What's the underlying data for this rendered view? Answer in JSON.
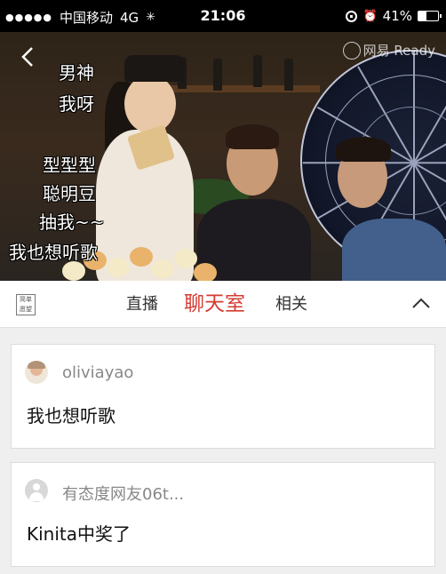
{
  "status_bar": {
    "carrier": "中国移动",
    "network": "4G",
    "time": "21:06",
    "battery": "41%",
    "battery_level": 0.41
  },
  "video": {
    "watermark": "网易 Ready",
    "danmaku": [
      "男神",
      "我呀",
      "型型型",
      "聪明豆",
      "抽我~~",
      "我也想听歌"
    ]
  },
  "tabs": [
    {
      "label": "直播",
      "active": false
    },
    {
      "label": "聊天室",
      "active": true
    },
    {
      "label": "相关",
      "active": false
    }
  ],
  "logo_text": "简单 愿望",
  "messages": [
    {
      "username": "oliviayao",
      "text": "我也想听歌",
      "avatar": "photo"
    },
    {
      "username": "有态度网友06t...",
      "text": "Kinita中奖了",
      "avatar": "default"
    }
  ],
  "colors": {
    "accent": "#d43c33"
  }
}
